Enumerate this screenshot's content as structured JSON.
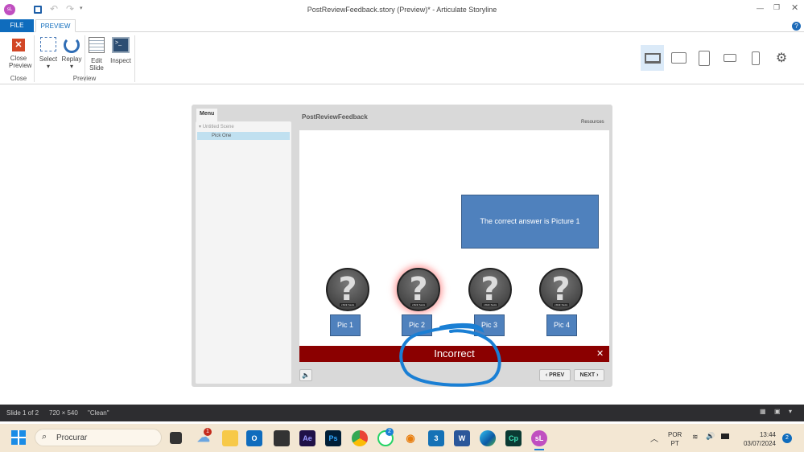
{
  "window": {
    "title": "PostReviewFeedback.story (Preview)* - Articulate Storyline",
    "app_icon": "sL"
  },
  "tabs": [
    {
      "label": "FILE"
    },
    {
      "label": "PREVIEW"
    }
  ],
  "ribbon": {
    "close_preview": "Close Preview",
    "close_group": "Close",
    "select": "Select",
    "replay": "Replay",
    "edit_slide": "Edit Slide",
    "inspect": "Inspect",
    "preview_group": "Preview"
  },
  "player": {
    "menu_tab": "Menu",
    "scene": "Untitled Scene",
    "menu_item": "Pick One",
    "title": "PostReviewFeedback",
    "resources": "Resources",
    "callout": "The correct answer is Picture 1",
    "pics": [
      {
        "label": "Pic 1",
        "badge": "click here"
      },
      {
        "label": "Pic 2",
        "badge": "click here"
      },
      {
        "label": "Pic 3",
        "badge": "click here"
      },
      {
        "label": "Pic 4",
        "badge": "click here"
      }
    ],
    "feedback": "Incorrect",
    "feedback_close": "✕",
    "prev": "‹ PREV",
    "next": "NEXT ›"
  },
  "status": {
    "slide": "Slide 1 of 2",
    "size": "720 × 540",
    "theme": "\"Clean\""
  },
  "taskbar": {
    "search": "Procurar",
    "weather_badge": "1",
    "whatsapp_badge": "2",
    "lang1": "POR",
    "lang2": "PT",
    "time": "13:44",
    "date": "03/07/2024",
    "notif": "2",
    "apps": [
      {
        "label": "Ae",
        "color": "#1f1147",
        "fg": "#9999ff"
      },
      {
        "label": "Ps",
        "color": "#001e36",
        "fg": "#31a8ff"
      },
      {
        "label": "Cp",
        "color": "#0b3a33",
        "fg": "#3ddfb5"
      }
    ]
  },
  "colors": {
    "accent": "#0f6cbd",
    "feedback": "#8b0000",
    "pic": "#4f81bd",
    "annotation": "#1a7fd4"
  }
}
